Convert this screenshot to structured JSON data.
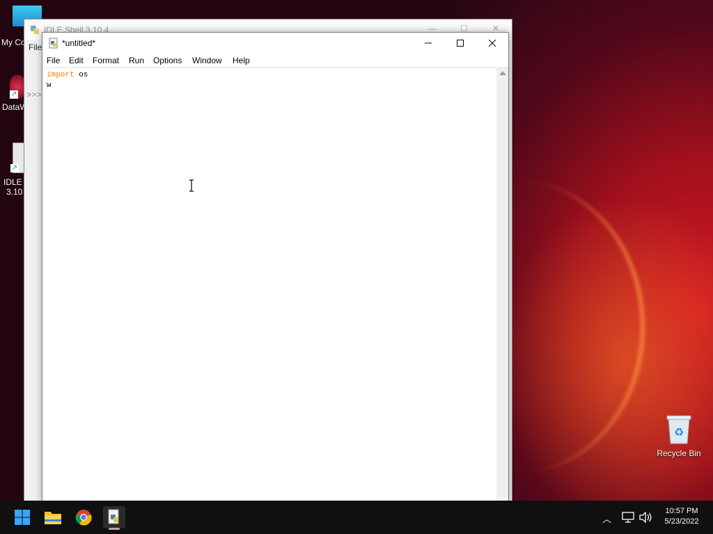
{
  "desktop": {
    "icons": [
      {
        "label": "My Co"
      },
      {
        "label": "DataW"
      },
      {
        "label": "IDLE (",
        "label2": "3.10"
      },
      {
        "label": "Recycle Bin"
      }
    ]
  },
  "shell_window": {
    "title": "IDLE Shell 3.10.4",
    "menu_first": "File",
    "prompt": ">>>"
  },
  "editor_window": {
    "title": "*untitled*",
    "menu": [
      "File",
      "Edit",
      "Format",
      "Run",
      "Options",
      "Window",
      "Help"
    ],
    "code_lines": [
      {
        "keyword": "import",
        "rest": " os"
      },
      {
        "keyword": "",
        "rest": "w"
      }
    ]
  },
  "taskbar": {
    "apps": [
      "start-icon",
      "file-explorer-icon",
      "chrome-icon",
      "idle-python-icon"
    ],
    "time": "10:57 PM",
    "date": "5/23/2022"
  }
}
